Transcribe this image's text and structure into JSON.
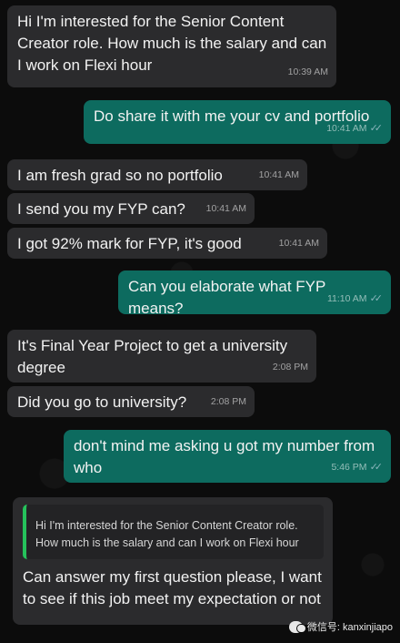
{
  "messages": [
    {
      "text": "Hi I'm interested for the Senior Content Creator role. How much is the salary and can I work on Flexi hour",
      "time": "10:39 AM"
    },
    {
      "text": "Do share it with me your cv and portfolio",
      "time": "10:41 AM",
      "ticks": "✓✓"
    },
    {
      "text": "I am fresh grad so no portfolio",
      "time": "10:41 AM"
    },
    {
      "text": "I send you my FYP can?",
      "time": "10:41 AM"
    },
    {
      "text": "I got 92% mark for FYP, it's good",
      "time": "10:41 AM"
    },
    {
      "text": "Can you elaborate what FYP means?",
      "time": "11:10 AM",
      "ticks": "✓✓"
    },
    {
      "text": "It's Final Year Project to get a university degree",
      "time": "2:08 PM"
    },
    {
      "text": "Did you go to university?",
      "time": "2:08 PM"
    },
    {
      "text": "don't mind me asking u got my number from who",
      "time": "5:46 PM",
      "ticks": "✓✓"
    },
    {
      "quote": "Hi I'm interested for the Senior Content Creator role. How much is the salary and can I work on Flexi hour",
      "text": "Can answer my first question please, I want to see if this job meet my expectation or not"
    }
  ],
  "watermark": {
    "text": "微信号: kanxinjiapo",
    "icon": "wechat-icon"
  },
  "colors": {
    "incoming": "#2b2b2d",
    "outgoing": "#0d6b5f",
    "quote_bar": "#25c25b",
    "background": "#0b0b0b"
  }
}
